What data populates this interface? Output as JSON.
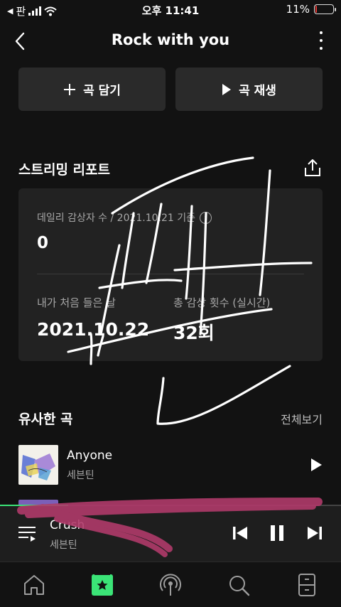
{
  "status_bar": {
    "carrier_back": "◀",
    "carrier": "판",
    "time": "오후 11:41",
    "battery": "11%",
    "battery_level": 0.11
  },
  "header": {
    "title": "Rock with you"
  },
  "actions": {
    "add_label": "곡 담기",
    "play_label": "곡 재생"
  },
  "report": {
    "title": "스트리밍 리포트",
    "daily_label": "데일리 감상자 수 / 2021.10.21 기준",
    "daily_value": "0",
    "first_listen_label": "내가 처음 들은 날",
    "first_listen_value": "2021.10.22",
    "total_plays_label": "총 감상 횟수 (실시간)",
    "total_plays_value": "32회"
  },
  "similar": {
    "title": "유사한 곡",
    "see_all": "전체보기",
    "songs": [
      {
        "name": "Anyone",
        "artist": "세븐틴"
      }
    ]
  },
  "player": {
    "title": "Crush",
    "artist": "세븐틴",
    "progress": 0.2
  },
  "nav": {
    "items": [
      "home-icon",
      "library-icon",
      "podcast-icon",
      "search-icon",
      "storage-icon"
    ],
    "active": "library-icon"
  },
  "colors": {
    "accent": "#3be477",
    "background": "#121212",
    "card": "#222222",
    "battery_low": "#e53935",
    "scribble": "#b03a6a"
  }
}
